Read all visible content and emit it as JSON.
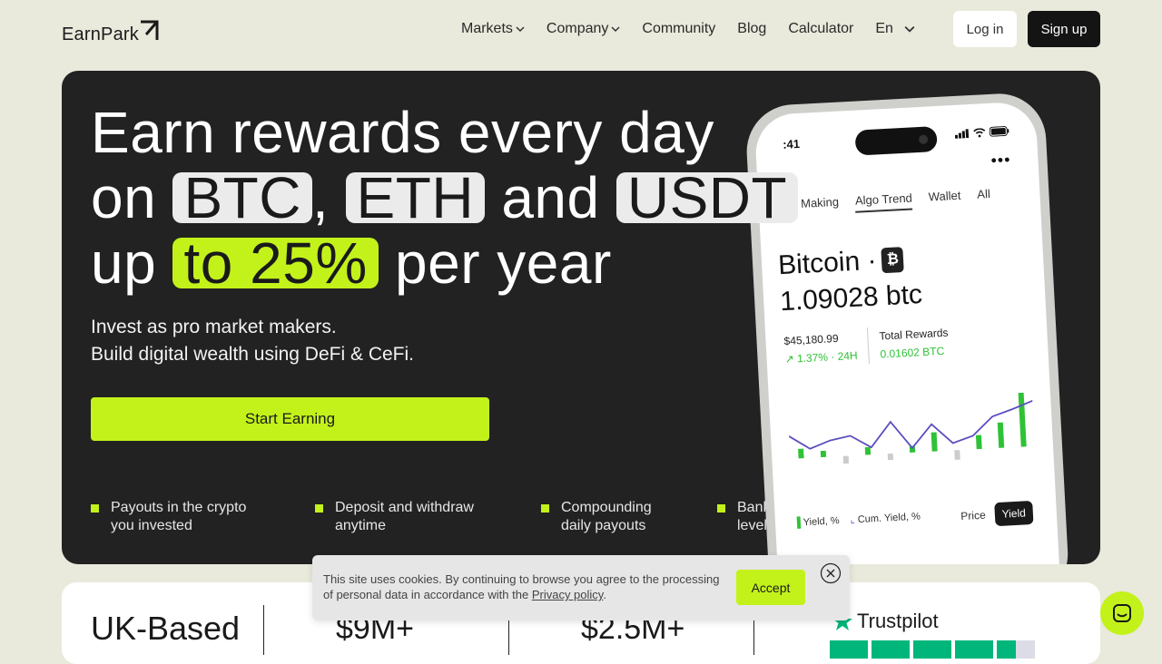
{
  "header": {
    "logo_text": "EarnPark",
    "nav": [
      {
        "label": "Markets",
        "has_dropdown": true
      },
      {
        "label": "Company",
        "has_dropdown": true
      },
      {
        "label": "Community",
        "has_dropdown": false
      },
      {
        "label": "Blog",
        "has_dropdown": false
      },
      {
        "label": "Calculator",
        "has_dropdown": false
      },
      {
        "label": "En",
        "has_dropdown": true
      }
    ],
    "login_label": "Log in",
    "signup_label": "Sign up"
  },
  "hero": {
    "line1": "Earn rewards every day",
    "line2_prefix": "on",
    "chip_btc": "BTC",
    "comma": ",",
    "chip_eth": "ETH",
    "and": "and",
    "chip_usdt": "USDT",
    "line3_prefix": "up",
    "chip_rate": "to 25%",
    "line3_suffix": "per year",
    "sub_line1": "Invest as pro market makers.",
    "sub_line2": "Build digital wealth using DeFi & CeFi.",
    "cta_label": "Start Earning",
    "features": [
      "Payouts in the crypto you invested",
      "Deposit and withdraw anytime",
      "Compounding daily payouts",
      "Bank-level se"
    ]
  },
  "phone": {
    "time": ":41",
    "tabs": [
      "arket Making",
      "Algo Trend",
      "Wallet",
      "All"
    ],
    "active_tab": "Algo Trend",
    "coin_name": "Bitcoin ·",
    "coin_symbol": "₿",
    "amount": "1.09028 btc",
    "price": "$45,180.99",
    "price_change": "↗ 1.37% · 24H",
    "rewards_label": "Total Rewards",
    "rewards_value": "0.01602 BTC",
    "legend_yield": "Yield, %",
    "legend_cum": "Cum. Yield, %",
    "toggle_price": "Price",
    "toggle_yield": "Yield",
    "line_values": [
      0.45,
      0.3,
      0.38,
      0.42,
      0.28,
      0.55,
      0.25,
      0.5,
      0.28,
      0.35,
      0.55,
      0.62,
      0.7
    ],
    "bar_values": [
      0.15,
      0.1,
      -0.12,
      0.12,
      -0.1,
      0.1,
      0.3,
      -0.15,
      0.22,
      0.4,
      0.85
    ],
    "accent_green": "#2fc236"
  },
  "cookie": {
    "text_prefix": "This site uses cookies. By continuing to browse you agree to the processing of personal data in accordance with the",
    "link_text": "Privacy policy",
    "text_suffix": ".",
    "accept_label": "Accept"
  },
  "stats": {
    "title": "UK-Based",
    "value1": "$9M+",
    "value2": "$2.5M+",
    "trustpilot": "Trustpilot"
  },
  "colors": {
    "accent": "#c3f21b",
    "background": "#e9e9dc",
    "hero_bg": "#222222",
    "trustpilot_green": "#00b67a"
  }
}
